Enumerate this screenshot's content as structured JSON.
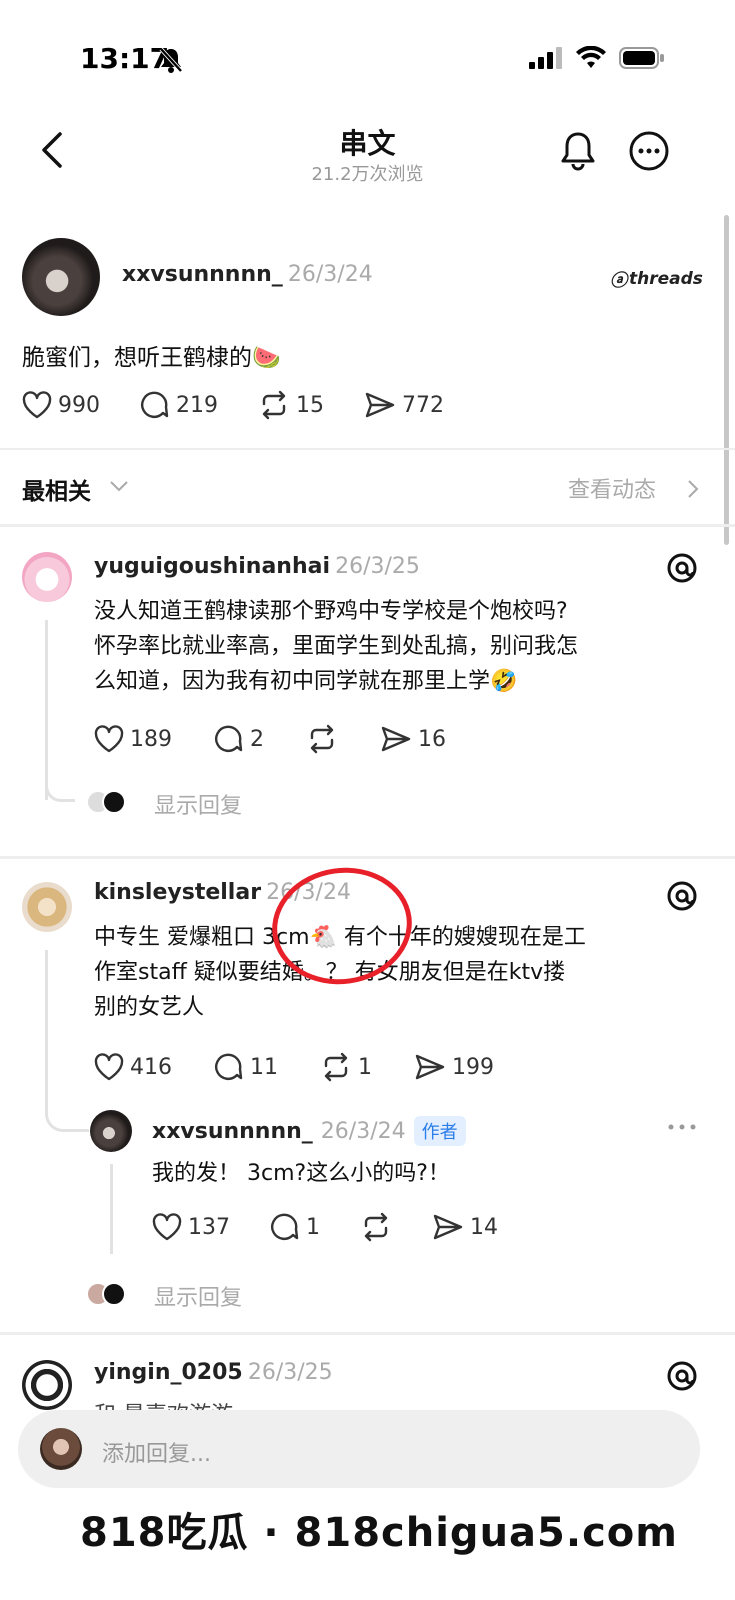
{
  "status_bar": {
    "time": "13:17"
  },
  "header": {
    "title": "串文",
    "subtitle": "21.2万次浏览"
  },
  "post": {
    "username": "xxvsunnnnn_",
    "date": "26/3/24",
    "badge": "threads",
    "text": "脆蜜们，想听王鹤棣的",
    "emoji": "🍉",
    "likes": "990",
    "comments": "219",
    "reposts": "15",
    "shares": "772"
  },
  "sort": {
    "label": "最相关",
    "activity_link": "查看动态"
  },
  "comments": [
    {
      "username": "yuguigoushinanhai",
      "date": "26/3/25",
      "lines": [
        "没人知道王鹤棣读那个野鸡中专学校是个炮校吗?",
        "怀孕率比就业率高，里面学生到处乱搞，别问我怎",
        "么知道，因为我有初中同学就在那里上学🤣"
      ],
      "likes": "189",
      "comments": "2",
      "reposts": "",
      "shares": "16",
      "show_replies": "显示回复"
    },
    {
      "username": "kinsleystellar",
      "date": "26/3/24",
      "lines": [
        "中专生 爱爆粗口 3cm🐔 有个十年的嫂嫂现在是工",
        "作室staff 疑似要结婚。？ 有女朋友但是在ktv搂",
        "别的女艺人"
      ],
      "likes": "416",
      "comments": "11",
      "reposts": "1",
      "shares": "199",
      "reply": {
        "username": "xxvsunnnnn_",
        "date": "26/3/24",
        "tag": "作者",
        "text": "我的发！ 3cm?这么小的吗?！",
        "likes": "137",
        "comments": "1",
        "reposts": "",
        "shares": "14"
      },
      "show_replies": "显示回复"
    },
    {
      "username": "yingin_0205",
      "date": "26/3/25",
      "partial_text": "和 最喜欢游游"
    }
  ],
  "reply_box": {
    "placeholder": "添加回复..."
  },
  "watermark": "818吃瓜 · 818chigua5.com",
  "colors": {
    "annotation_circle": "#e8202a",
    "author_tag": "#2b7de9",
    "muted": "#aaaaaa"
  }
}
